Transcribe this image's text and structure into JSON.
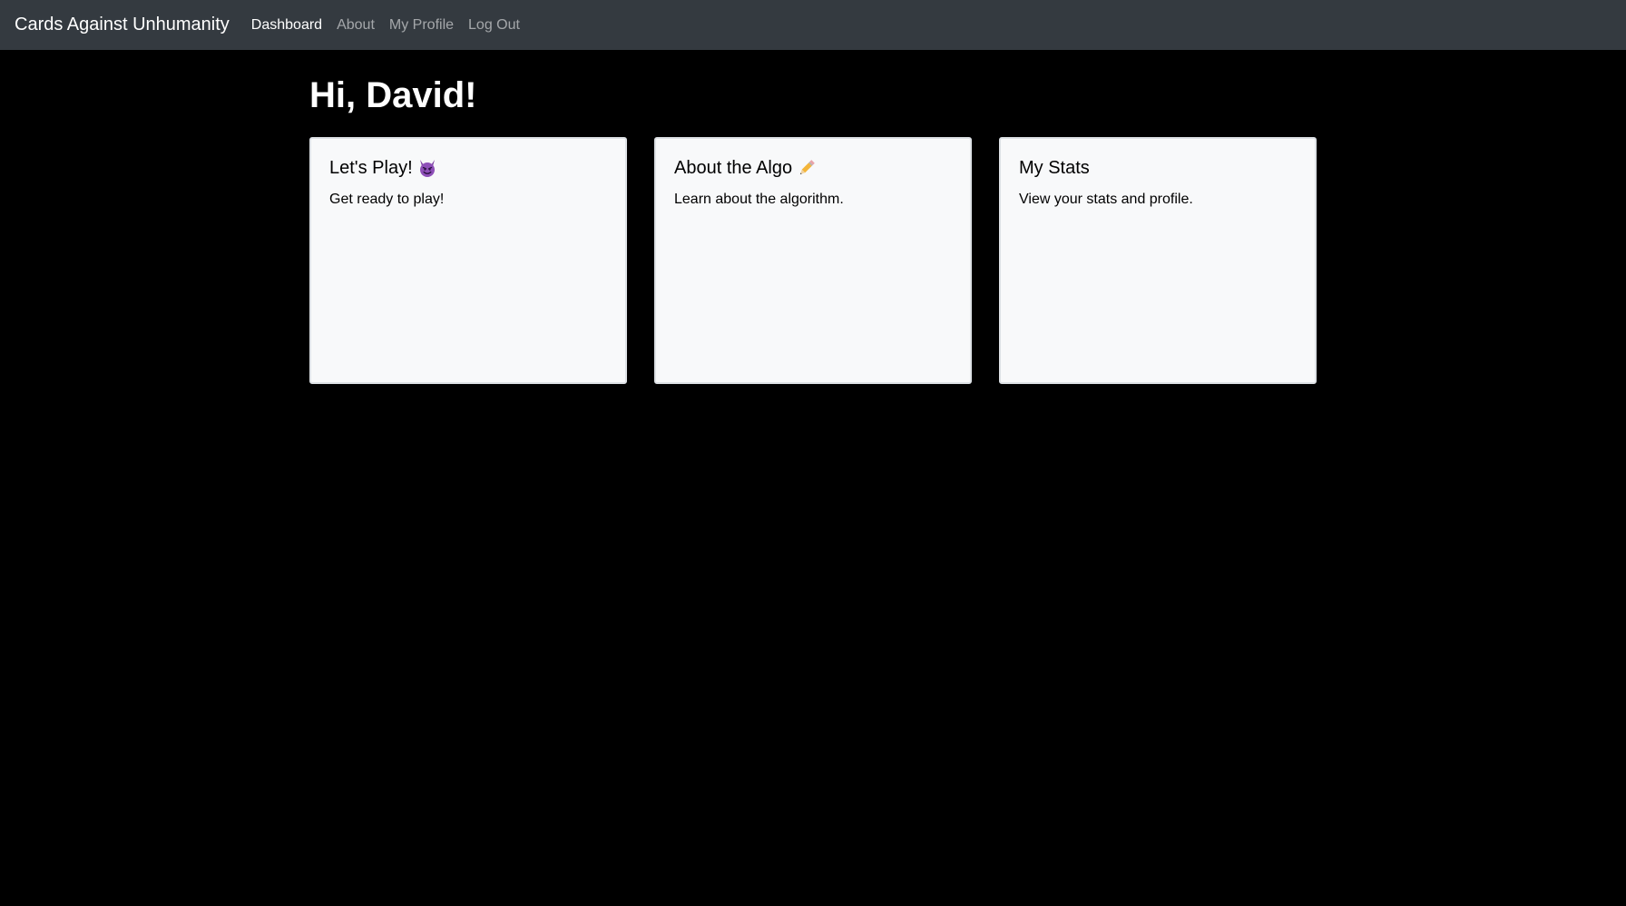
{
  "navbar": {
    "brand": "Cards Against Unhumanity",
    "links": [
      {
        "label": "Dashboard",
        "active": true
      },
      {
        "label": "About",
        "active": false
      },
      {
        "label": "My Profile",
        "active": false
      },
      {
        "label": "Log Out",
        "active": false
      }
    ]
  },
  "main": {
    "greeting": "Hi, David!",
    "cards": [
      {
        "title": "Let's Play!",
        "icon": "smiling-devil-icon",
        "text": "Get ready to play!"
      },
      {
        "title": "About the Algo",
        "icon": "pencil-icon",
        "text": "Learn about the algorithm."
      },
      {
        "title": "My Stats",
        "icon": "",
        "text": "View your stats and profile."
      }
    ]
  },
  "colors": {
    "page_background": "#000000",
    "navbar_background": "#343a40",
    "card_background": "#f8f9fa",
    "card_border": "#dee2e6"
  }
}
